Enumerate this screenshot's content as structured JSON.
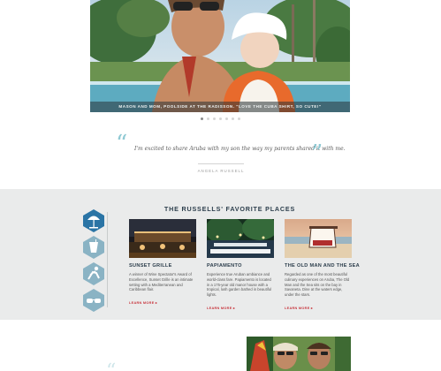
{
  "hero": {
    "caption": "MASON AND MOM, POOLSIDE AT THE RADISSON. \"LOVE THE CUBA SHIRT, SO CUTE!\"",
    "slide_count": 7,
    "active_slide": 1
  },
  "quote": {
    "open_mark": "“",
    "close_mark": "”",
    "text": "I'm excited to share Aruba with my son the way my parents shared it with me.",
    "author": "ANGELA RUSSELL"
  },
  "favorites": {
    "title": "THE RUSSELLS' FAVORITE PLACES",
    "categories": [
      "beach-umbrella-icon",
      "cocktail-icon",
      "swimmer-icon",
      "sunglasses-icon"
    ],
    "active_category": 0,
    "cards": [
      {
        "name": "SUNSET GRILLE",
        "description": "A winner of Wine Spectator's Award of Excellence, Sunset Grille is an intimate setting with a Mediterranean and Caribbean flair.",
        "link": "LEARN MORE ▸"
      },
      {
        "name": "PAPIAMENTO",
        "description": "Experience true Aruban ambiance and world-class fare. Papiamento is located in a 175-year old manor house with a tropical, lush garden bathed in beautiful lights.",
        "link": "LEARN MORE ▸"
      },
      {
        "name": "THE OLD MAN AND THE SEA",
        "description": "Regarded as one of the most beautiful culinary experiences on Aruba, The Old Man and the Sea sits on the bay in Savaneta. Dine at the waters edge, under the stars.",
        "link": "LEARN MORE ▸"
      }
    ]
  },
  "bottom": {
    "open_mark": "“"
  },
  "colors": {
    "accent": "#8fc9d3",
    "hex_active": "#2a74a5",
    "hex_inactive": "#8ab3c4",
    "link": "#c8353d",
    "section_bg": "#eaebeb"
  }
}
